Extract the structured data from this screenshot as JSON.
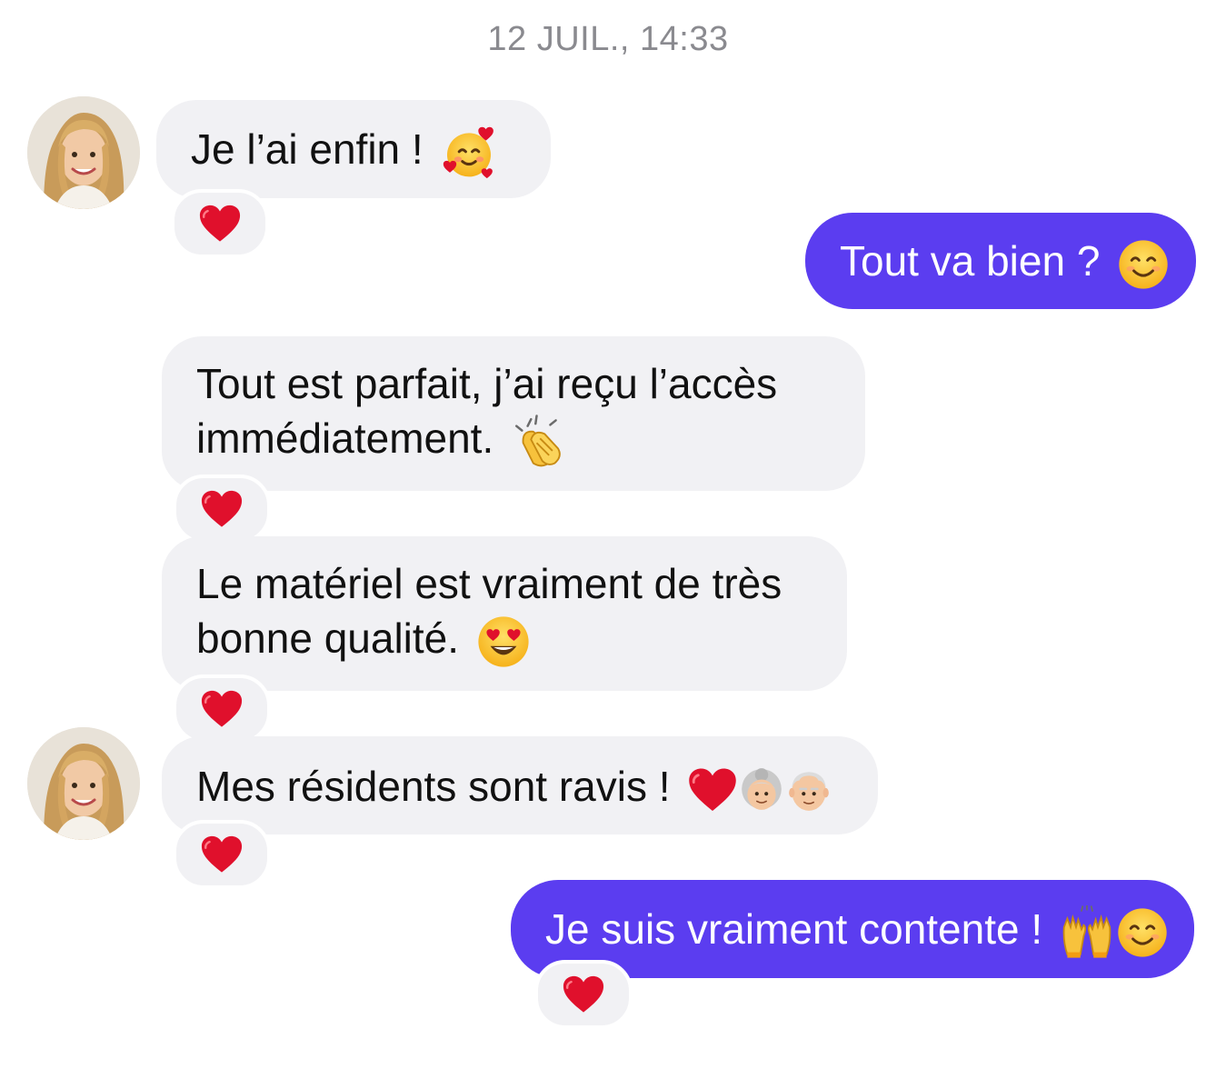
{
  "conversation": {
    "timestamp": "12 JUIL., 14:33",
    "messages": [
      {
        "from": "them",
        "text": "Je l’ai enfin !",
        "emoji": [
          "smiling-face-with-hearts"
        ],
        "reaction": "heart"
      },
      {
        "from": "me",
        "text": "Tout va bien ?",
        "emoji": [
          "smiling-face"
        ]
      },
      {
        "from": "them",
        "lines": [
          "Tout est parfait, j’ai reçu l’accès",
          "immédiatement."
        ],
        "emoji": [
          "clapping-hands"
        ],
        "reaction": "heart"
      },
      {
        "from": "them",
        "lines": [
          "Le matériel est vraiment de très",
          "bonne qualité."
        ],
        "emoji": [
          "heart-eyes"
        ],
        "reaction": "heart"
      },
      {
        "from": "them",
        "text": "Mes résidents sont ravis !",
        "emoji": [
          "red-heart",
          "old-woman",
          "old-man"
        ],
        "reaction": "heart"
      },
      {
        "from": "me",
        "text": "Je suis vraiment contente !",
        "emoji": [
          "raising-hands",
          "smiling-face"
        ],
        "reaction": "heart"
      }
    ]
  },
  "colors": {
    "outgoing_bubble": "#5b3df0",
    "incoming_bubble": "#f1f1f4",
    "timestamp": "#8a8a8f",
    "reaction_heart": "#e0102c"
  }
}
